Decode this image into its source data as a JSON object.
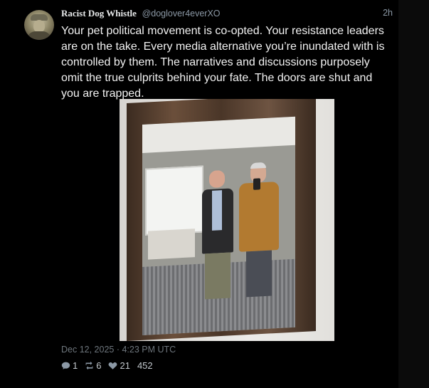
{
  "tweet": {
    "display_name": "Racist Dog Whistle",
    "handle": "@doglover4everXO",
    "time_ago": "2h",
    "text": "Your pet political movement is co-opted. Your resistance leaders are on the take. Every media alternative you’re inundated with is controlled by them. The narratives and discussions purposely omit the true culprits behind your fate. The doors are shut and you are trapped.",
    "date": "Dec 12, 2025 · 4:23 PM UTC",
    "stats": {
      "replies": "1",
      "retweets": "6",
      "likes": "21",
      "views": "452"
    },
    "avatar_icon": "profile-avatar",
    "media_icon": "mirror-selfie-photo"
  },
  "colors": {
    "background": "#000000",
    "primary_text": "#e7e9ea",
    "secondary_text": "#8b98a5",
    "date_text": "#6e767d"
  }
}
